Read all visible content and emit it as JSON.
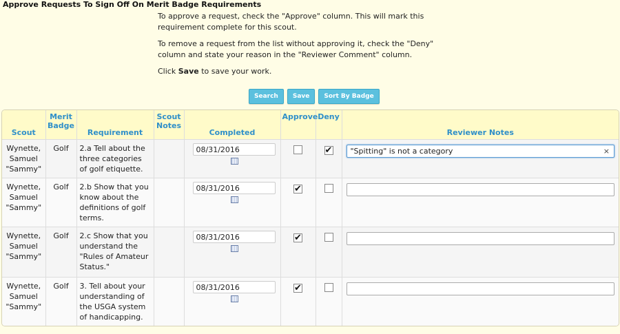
{
  "page": {
    "title": "Approve Requests To Sign Off On Merit Badge Requirements"
  },
  "instructions": {
    "p1": "To approve a request, check the \"Approve\" column.  This will mark this requirement complete for this scout.",
    "p2": "To remove a request from the list without approving it, check the \"Deny\" column and state your reason in the \"Reviewer Comment\" column.",
    "p3_prefix": "Click ",
    "p3_bold": "Save",
    "p3_suffix": " to save your work."
  },
  "toolbar": {
    "search_label": "Search",
    "save_label": "Save",
    "sort_label": "Sort By Badge"
  },
  "columns": {
    "scout": "Scout",
    "badge": "Merit Badge",
    "requirement": "Requirement",
    "scout_notes": "Scout Notes",
    "completed": "Completed",
    "approve": "Approve",
    "deny": "Deny",
    "reviewer_notes": "Reviewer Notes"
  },
  "rows": [
    {
      "scout": "Wynette, Samuel \"Sammy\"",
      "badge": "Golf",
      "requirement": "2.a  Tell about the three categories of golf etiquette.",
      "scout_notes": "",
      "completed": "08/31/2016",
      "approve": false,
      "deny": true,
      "reviewer_note": "\"Spitting\" is not a category"
    },
    {
      "scout": "Wynette, Samuel \"Sammy\"",
      "badge": "Golf",
      "requirement": "2.b  Show that you know about the definitions of golf terms.",
      "scout_notes": "",
      "completed": "08/31/2016",
      "approve": true,
      "deny": false,
      "reviewer_note": ""
    },
    {
      "scout": "Wynette, Samuel \"Sammy\"",
      "badge": "Golf",
      "requirement": "2.c  Show that you understand the \"Rules of Amateur Status.\"",
      "scout_notes": "",
      "completed": "08/31/2016",
      "approve": true,
      "deny": false,
      "reviewer_note": ""
    },
    {
      "scout": "Wynette, Samuel \"Sammy\"",
      "badge": "Golf",
      "requirement": "3.  Tell about your understanding of the USGA system of handicapping.",
      "scout_notes": "",
      "completed": "08/31/2016",
      "approve": true,
      "deny": false,
      "reviewer_note": ""
    }
  ],
  "colors": {
    "background": "#fffde6",
    "header_bg": "#fffbc9",
    "header_text": "#2f8fc9",
    "button_bg": "#5bc0de"
  },
  "icons": {
    "calendar": "calendar-icon",
    "checkmark": "✔",
    "clear": "×"
  }
}
